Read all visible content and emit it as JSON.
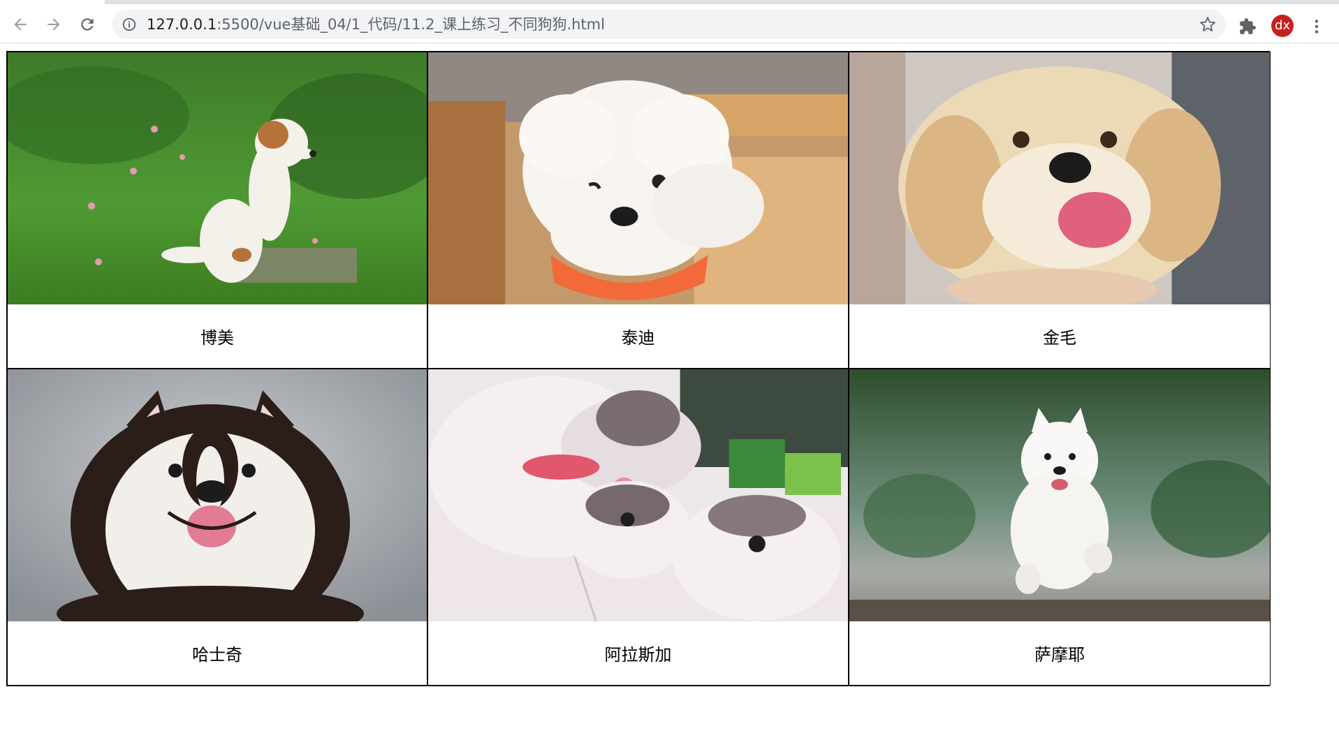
{
  "browser": {
    "url_host": "127.0.0.1",
    "url_rest": ":5500/vue基础_04/1_代码/11.2_课上练习_不同狗狗.html",
    "profile_initials": "dx",
    "icons": {
      "back": "back-arrow-icon",
      "forward": "forward-arrow-icon",
      "reload": "reload-icon",
      "site_info": "info-icon",
      "bookmark": "star-icon",
      "extensions": "puzzle-icon",
      "menu": "kebab-menu-icon"
    }
  },
  "colors": {
    "avatar_bg": "#c5221f",
    "omnibox_bg": "#f1f3f4",
    "border": "#000000"
  },
  "dogs": [
    {
      "name": "博美"
    },
    {
      "name": "泰迪"
    },
    {
      "name": "金毛"
    },
    {
      "name": "哈士奇"
    },
    {
      "name": "阿拉斯加"
    },
    {
      "name": "萨摩耶"
    }
  ]
}
